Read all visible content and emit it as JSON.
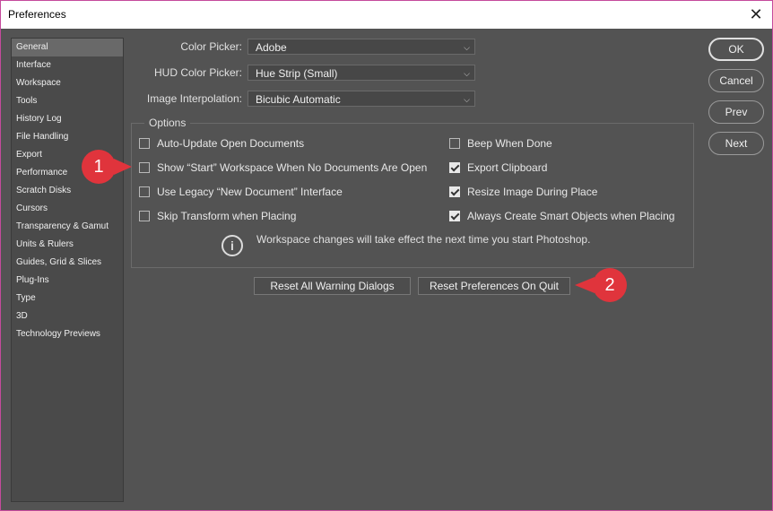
{
  "window": {
    "title": "Preferences",
    "close_glyph": "✕"
  },
  "sidebar": {
    "items": [
      {
        "label": "General",
        "active": true
      },
      {
        "label": "Interface"
      },
      {
        "label": "Workspace"
      },
      {
        "label": "Tools"
      },
      {
        "label": "History Log"
      },
      {
        "label": "File Handling"
      },
      {
        "label": "Export"
      },
      {
        "label": "Performance"
      },
      {
        "label": "Scratch Disks"
      },
      {
        "label": "Cursors"
      },
      {
        "label": "Transparency & Gamut"
      },
      {
        "label": "Units & Rulers"
      },
      {
        "label": "Guides, Grid & Slices"
      },
      {
        "label": "Plug-Ins"
      },
      {
        "label": "Type"
      },
      {
        "label": "3D"
      },
      {
        "label": "Technology Previews"
      }
    ]
  },
  "fields": {
    "color_picker": {
      "label": "Color Picker:",
      "value": "Adobe"
    },
    "hud_color_picker": {
      "label": "HUD Color Picker:",
      "value": "Hue Strip (Small)"
    },
    "image_interpolation": {
      "label": "Image Interpolation:",
      "value": "Bicubic Automatic"
    }
  },
  "options": {
    "legend": "Options",
    "left": [
      {
        "label": "Auto-Update Open Documents",
        "checked": false
      },
      {
        "label": "Show “Start” Workspace When No Documents Are Open",
        "checked": false
      },
      {
        "label": "Use Legacy “New Document” Interface",
        "checked": false
      },
      {
        "label": "Skip Transform when Placing",
        "checked": false
      }
    ],
    "right": [
      {
        "label": "Beep When Done",
        "checked": false
      },
      {
        "label": "Export Clipboard",
        "checked": true
      },
      {
        "label": "Resize Image During Place",
        "checked": true
      },
      {
        "label": "Always Create Smart Objects when Placing",
        "checked": true
      }
    ],
    "info_glyph": "i",
    "info_text": "Workspace changes will take effect the next time you start Photoshop."
  },
  "buttons": {
    "reset_warnings": "Reset All Warning Dialogs",
    "reset_prefs": "Reset Preferences On Quit",
    "ok": "OK",
    "cancel": "Cancel",
    "prev": "Prev",
    "next": "Next"
  },
  "callouts": {
    "one": "1",
    "two": "2",
    "color": "#e0343c"
  },
  "icons": {
    "close": "close-icon",
    "chevron": "chevron-down-icon",
    "info": "info-icon",
    "check": "checkmark-icon"
  }
}
